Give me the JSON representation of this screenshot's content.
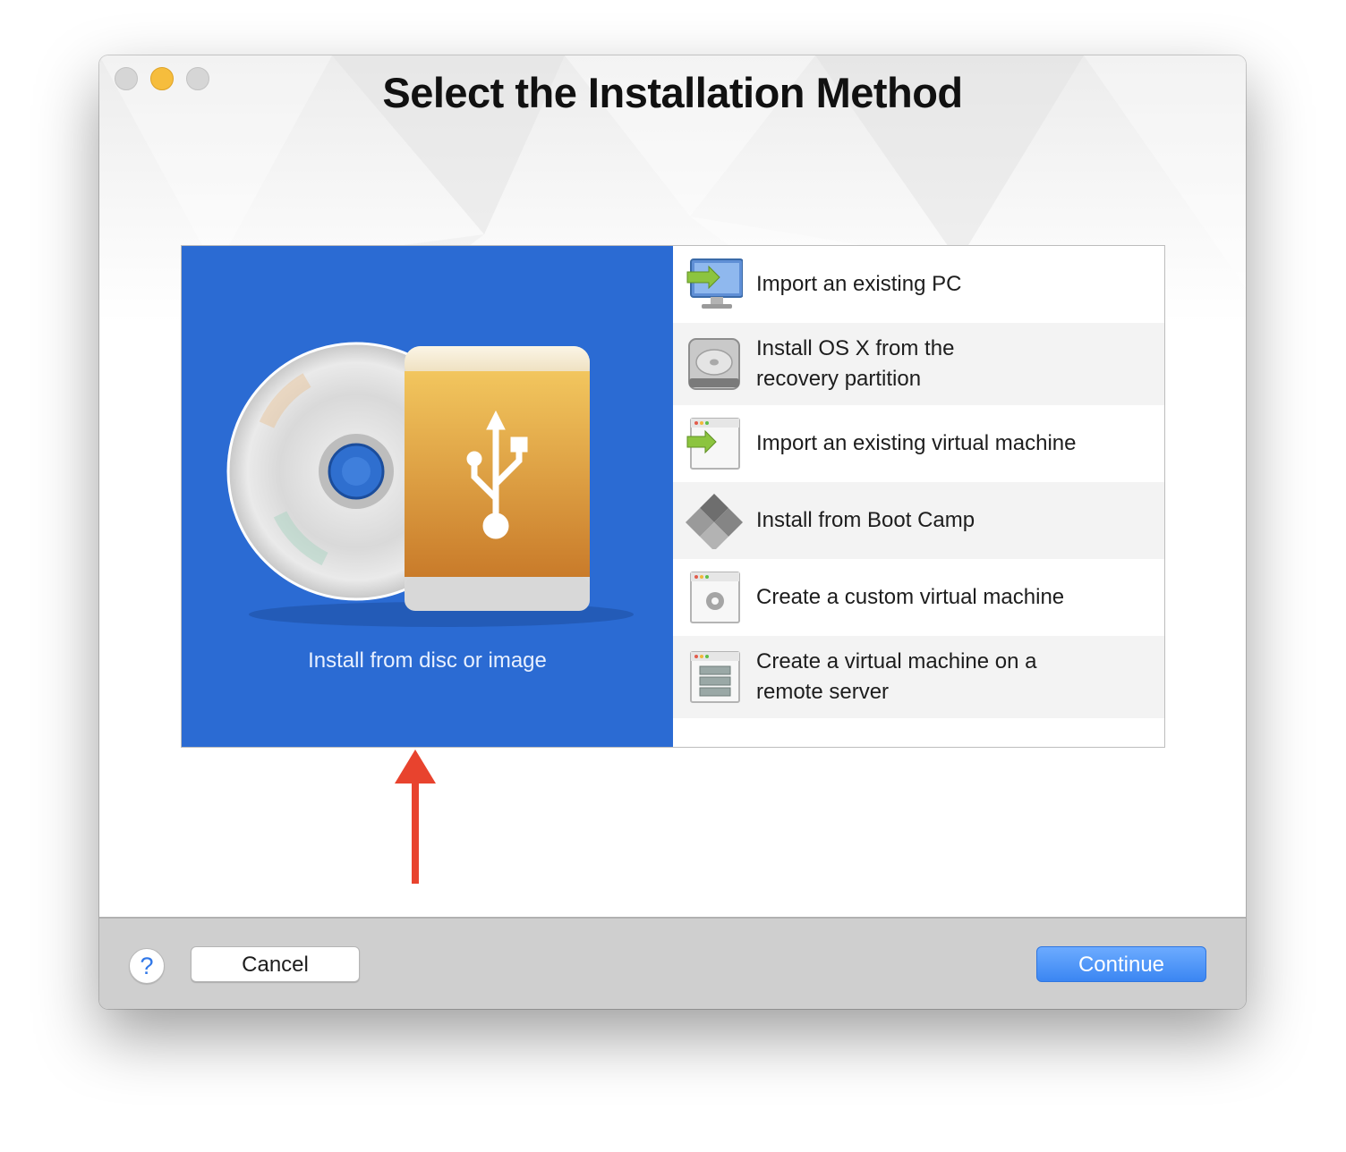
{
  "window": {
    "title": "Select the Installation Method"
  },
  "featured_option": {
    "label": "Install from disc or image",
    "selected": true
  },
  "options": [
    {
      "label_line1": "Import an existing PC",
      "label_line2": "",
      "icon": "pc-import-icon"
    },
    {
      "label_line1": "Install OS X from the",
      "label_line2": "recovery partition",
      "icon": "hard-drive-icon"
    },
    {
      "label_line1": "Import an existing virtual machine",
      "label_line2": "",
      "icon": "vm-import-icon"
    },
    {
      "label_line1": "Install from Boot Camp",
      "label_line2": "",
      "icon": "boot-camp-icon"
    },
    {
      "label_line1": "Create a custom virtual machine",
      "label_line2": "",
      "icon": "custom-vm-icon"
    },
    {
      "label_line1": "Create a virtual machine on a",
      "label_line2": "remote server",
      "icon": "remote-server-icon"
    }
  ],
  "footer": {
    "help_label": "?",
    "cancel_label": "Cancel",
    "continue_label": "Continue"
  },
  "colors": {
    "selected_tile": "#2b6bd3",
    "continue_button": "#3b86f2",
    "annotation_arrow": "#e8432e",
    "minimize_button": "#f6bd3d"
  }
}
